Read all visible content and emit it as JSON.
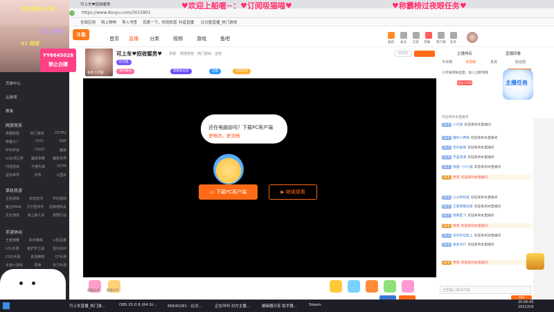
{
  "browser": {
    "url": "https://www.douyu.com/3015801",
    "tab_label": "可上车♥招收暖男"
  },
  "banner": {
    "left": "♥欢迎上船喔~：♥订阅吸猫喵♥",
    "right": "♥称霸榜过夜眼任务♥"
  },
  "bookmarks": [
    {
      "label": "全部应用"
    },
    {
      "label": "网上购物"
    },
    {
      "label": "导入书签"
    },
    {
      "label": "百度一下，你就知道"
    },
    {
      "label": "抖音直播"
    },
    {
      "label": "比次驱直播_热门游戏"
    }
  ],
  "overlay": {
    "top_label": "欢迎主播小可爱",
    "x1_label": "X1 加号",
    "yy_id": "YY6645028",
    "yy_sub": "禁止白嫖",
    "x1b": "X1 网球"
  },
  "sidebar": {
    "menu": [
      {
        "label": "页游中心"
      },
      {
        "label": "云游戏"
      },
      {
        "label": "赛事"
      }
    ],
    "sections": [
      {
        "title": "网游竞技",
        "rows": [
          [
            "英雄联盟",
            "热门游戏",
            "DOTA2"
          ],
          [
            "英雄大厂",
            "CF/D",
            "DNF"
          ],
          [
            "炉石传说",
            "CSGO",
            "魔兽"
          ],
          [
            "lol云顶之弈",
            "魔兽争霸",
            "魔兽世界"
          ],
          [
            "问道游戏",
            "守望先锋",
            "DOTA"
          ],
          [
            "星际世界",
            "传奇",
            "三国杀"
          ]
        ]
      },
      {
        "title": "单机热游",
        "rows": [
          [
            "主机游戏",
            "永劫无间",
            "怀旧游戏"
          ],
          [
            "鬼泣PARK",
            "艾尔登法环",
            "逃离塔科夫"
          ],
          [
            "文化游戏",
            "海上狼人杀",
            "荒野行动"
          ]
        ]
      },
      {
        "title": "手游休闲",
        "rows": [
          [
            "王者荣耀",
            "和平精英",
            "火影忍者"
          ],
          [
            "LOL手游",
            "金铲铲之战",
            "蛋仔派对"
          ],
          [
            "COD手游",
            "新游推荐",
            "CF手游"
          ],
          [
            "手游小游戏",
            "原神",
            "天刀手游"
          ]
        ]
      }
    ]
  },
  "header": {
    "logo": "斗鱼",
    "nav": [
      {
        "label": "首页"
      },
      {
        "label": "直播"
      },
      {
        "label": "分类"
      },
      {
        "label": "视频"
      },
      {
        "label": "游戏"
      },
      {
        "label": "鱼吧"
      }
    ],
    "icons": [
      {
        "label": "鱼吧"
      },
      {
        "label": "关注"
      },
      {
        "label": "历史"
      },
      {
        "label": "开播"
      },
      {
        "label": "客户端"
      },
      {
        "label": "任务"
      }
    ]
  },
  "room": {
    "title": "可上车♥招收暖男♥",
    "report": "举报",
    "category": "网游竞技 - 热门游戏 - 全部",
    "fans": "13752",
    "streamer_name": "鱼吧 小可爱",
    "tags": [
      {
        "label": "比次驱",
        "color": "#7a57ff"
      },
      {
        "label": "比次驱",
        "color": "#2d9cff"
      },
      {
        "label": "福利驱动",
        "color": "#ff6a9b"
      },
      {
        "label": "超级粉丝团",
        "color": "#6a4bff"
      },
      {
        "label": "全能",
        "color": "#3399ff"
      },
      {
        "label": "当前热度",
        "color": "#ff6a16"
      }
    ]
  },
  "video": {
    "prompt_line1": "还在电脑前吗？下载PC客户端",
    "prompt_line2": "更畅流，更流畅",
    "download_btn": "下载PC客户端",
    "continue_btn": "继续观看"
  },
  "gifts": [
    {
      "label": "超级分享",
      "color": "#ff9fc7"
    },
    {
      "label": "超级大礼",
      "color": "#ffd27a"
    },
    {
      "label": "",
      "color": "#ffca3a"
    },
    {
      "label": "",
      "color": "#7ad1ff"
    },
    {
      "label": "",
      "color": "#ff8a3a"
    },
    {
      "label": "",
      "color": "#8ee07a"
    },
    {
      "label": "",
      "color": "#ff9bd2"
    }
  ],
  "rank": {
    "tabs": [
      "主播排名",
      "直播回看"
    ],
    "sub_tabs": [
      "今日榜",
      "本周榜",
      "贵宾",
      "粉丝团"
    ],
    "follow_label": "小可爱的粉丝团，加入立即领取",
    "open_btn": "开通贵族",
    "chat_header": "欢迎来到本直播间",
    "event_text": "活动 +100"
  },
  "chat": [
    {
      "lv": "LV 5",
      "name": "小可爱",
      "text": "欢迎来到本直播间"
    },
    {
      "lv": "LV 6",
      "name": "雁鸣小神探",
      "text": "欢迎来到本直播间"
    },
    {
      "lv": "LV 3",
      "name": "空间星辰",
      "text": "欢迎来到本直播间"
    },
    {
      "lv": "LV 8",
      "name": "宇宙浪漫",
      "text": "欢迎来到本直播间"
    },
    {
      "lv": "LV 2",
      "name": "我是一只小猫",
      "text": "欢迎来到本直播间"
    },
    {
      "lv": "LV 9",
      "name": "贵宾",
      "text": "欢迎来到本直播间",
      "gift": true
    },
    {
      "lv": "LV 4",
      "name": "三分钟热度",
      "text": "欢迎来到本直播间"
    },
    {
      "lv": "LV 5",
      "name": "王者荣耀玩家",
      "text": "欢迎来到本直播间"
    },
    {
      "lv": "LV 7",
      "name": "我要起飞",
      "text": "欢迎来到本直播间"
    },
    {
      "lv": "LV 9",
      "name": "贵宾",
      "text": "欢迎来到本直播间",
      "gift": true
    },
    {
      "lv": "LV 3",
      "name": "凉风吹在脸上",
      "text": "欢迎来到本直播间"
    },
    {
      "lv": "LV 6",
      "name": "星星点灯",
      "text": "欢迎来到本直播间"
    },
    {
      "lv": "LV 9",
      "name": "贵宾",
      "text": "欢迎来到本直播间",
      "gift": true
    }
  ],
  "chat_input": {
    "placeholder": "这里输入聊天内容",
    "send": "发送"
  },
  "badge": {
    "label": "主播任务"
  },
  "taskbar": {
    "items": [
      {
        "label": "可上车直播_热门游..."
      },
      {
        "label": "OBS 25.0.8 (64 Gi..."
      },
      {
        "label": "66540281 - 比次..."
      },
      {
        "label": "正在叫叫 对方主播..."
      },
      {
        "label": "编辑器分享 助手器..."
      },
      {
        "label": "Steam"
      }
    ],
    "time": "20:06:00",
    "date": "2022/5/9"
  },
  "colors": {
    "accent": "#ff6a16",
    "sidebar": "#25272c",
    "banner": "#ff2d6a"
  }
}
